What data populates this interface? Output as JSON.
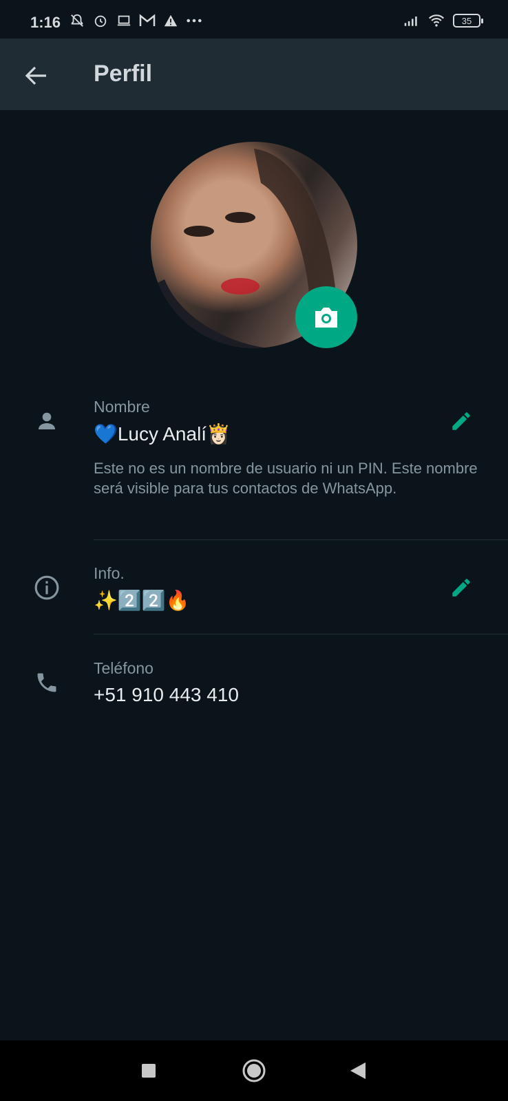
{
  "status_bar": {
    "time": "1:16",
    "battery": "35",
    "icons_left": [
      "notifications-off-icon",
      "alarm-icon",
      "laptop-icon",
      "gmail-icon",
      "warning-icon",
      "more-dots-icon"
    ],
    "icons_right": [
      "signal-icon",
      "wifi-icon",
      "battery-icon"
    ]
  },
  "header": {
    "title": "Perfil"
  },
  "profile": {
    "name_label": "Nombre",
    "name_value": "💙Lucy Analí👸🏻",
    "name_hint": "Este no es un nombre de usuario ni un PIN. Este nombre será visible para tus contactos de WhatsApp.",
    "info_label": "Info.",
    "info_value": "✨2️⃣2️⃣🔥",
    "phone_label": "Teléfono",
    "phone_value": "+51 910 443 410"
  },
  "colors": {
    "background": "#0b141a",
    "appbar": "#1f2c34",
    "accent": "#00a884",
    "secondary_text": "#8696a0"
  }
}
